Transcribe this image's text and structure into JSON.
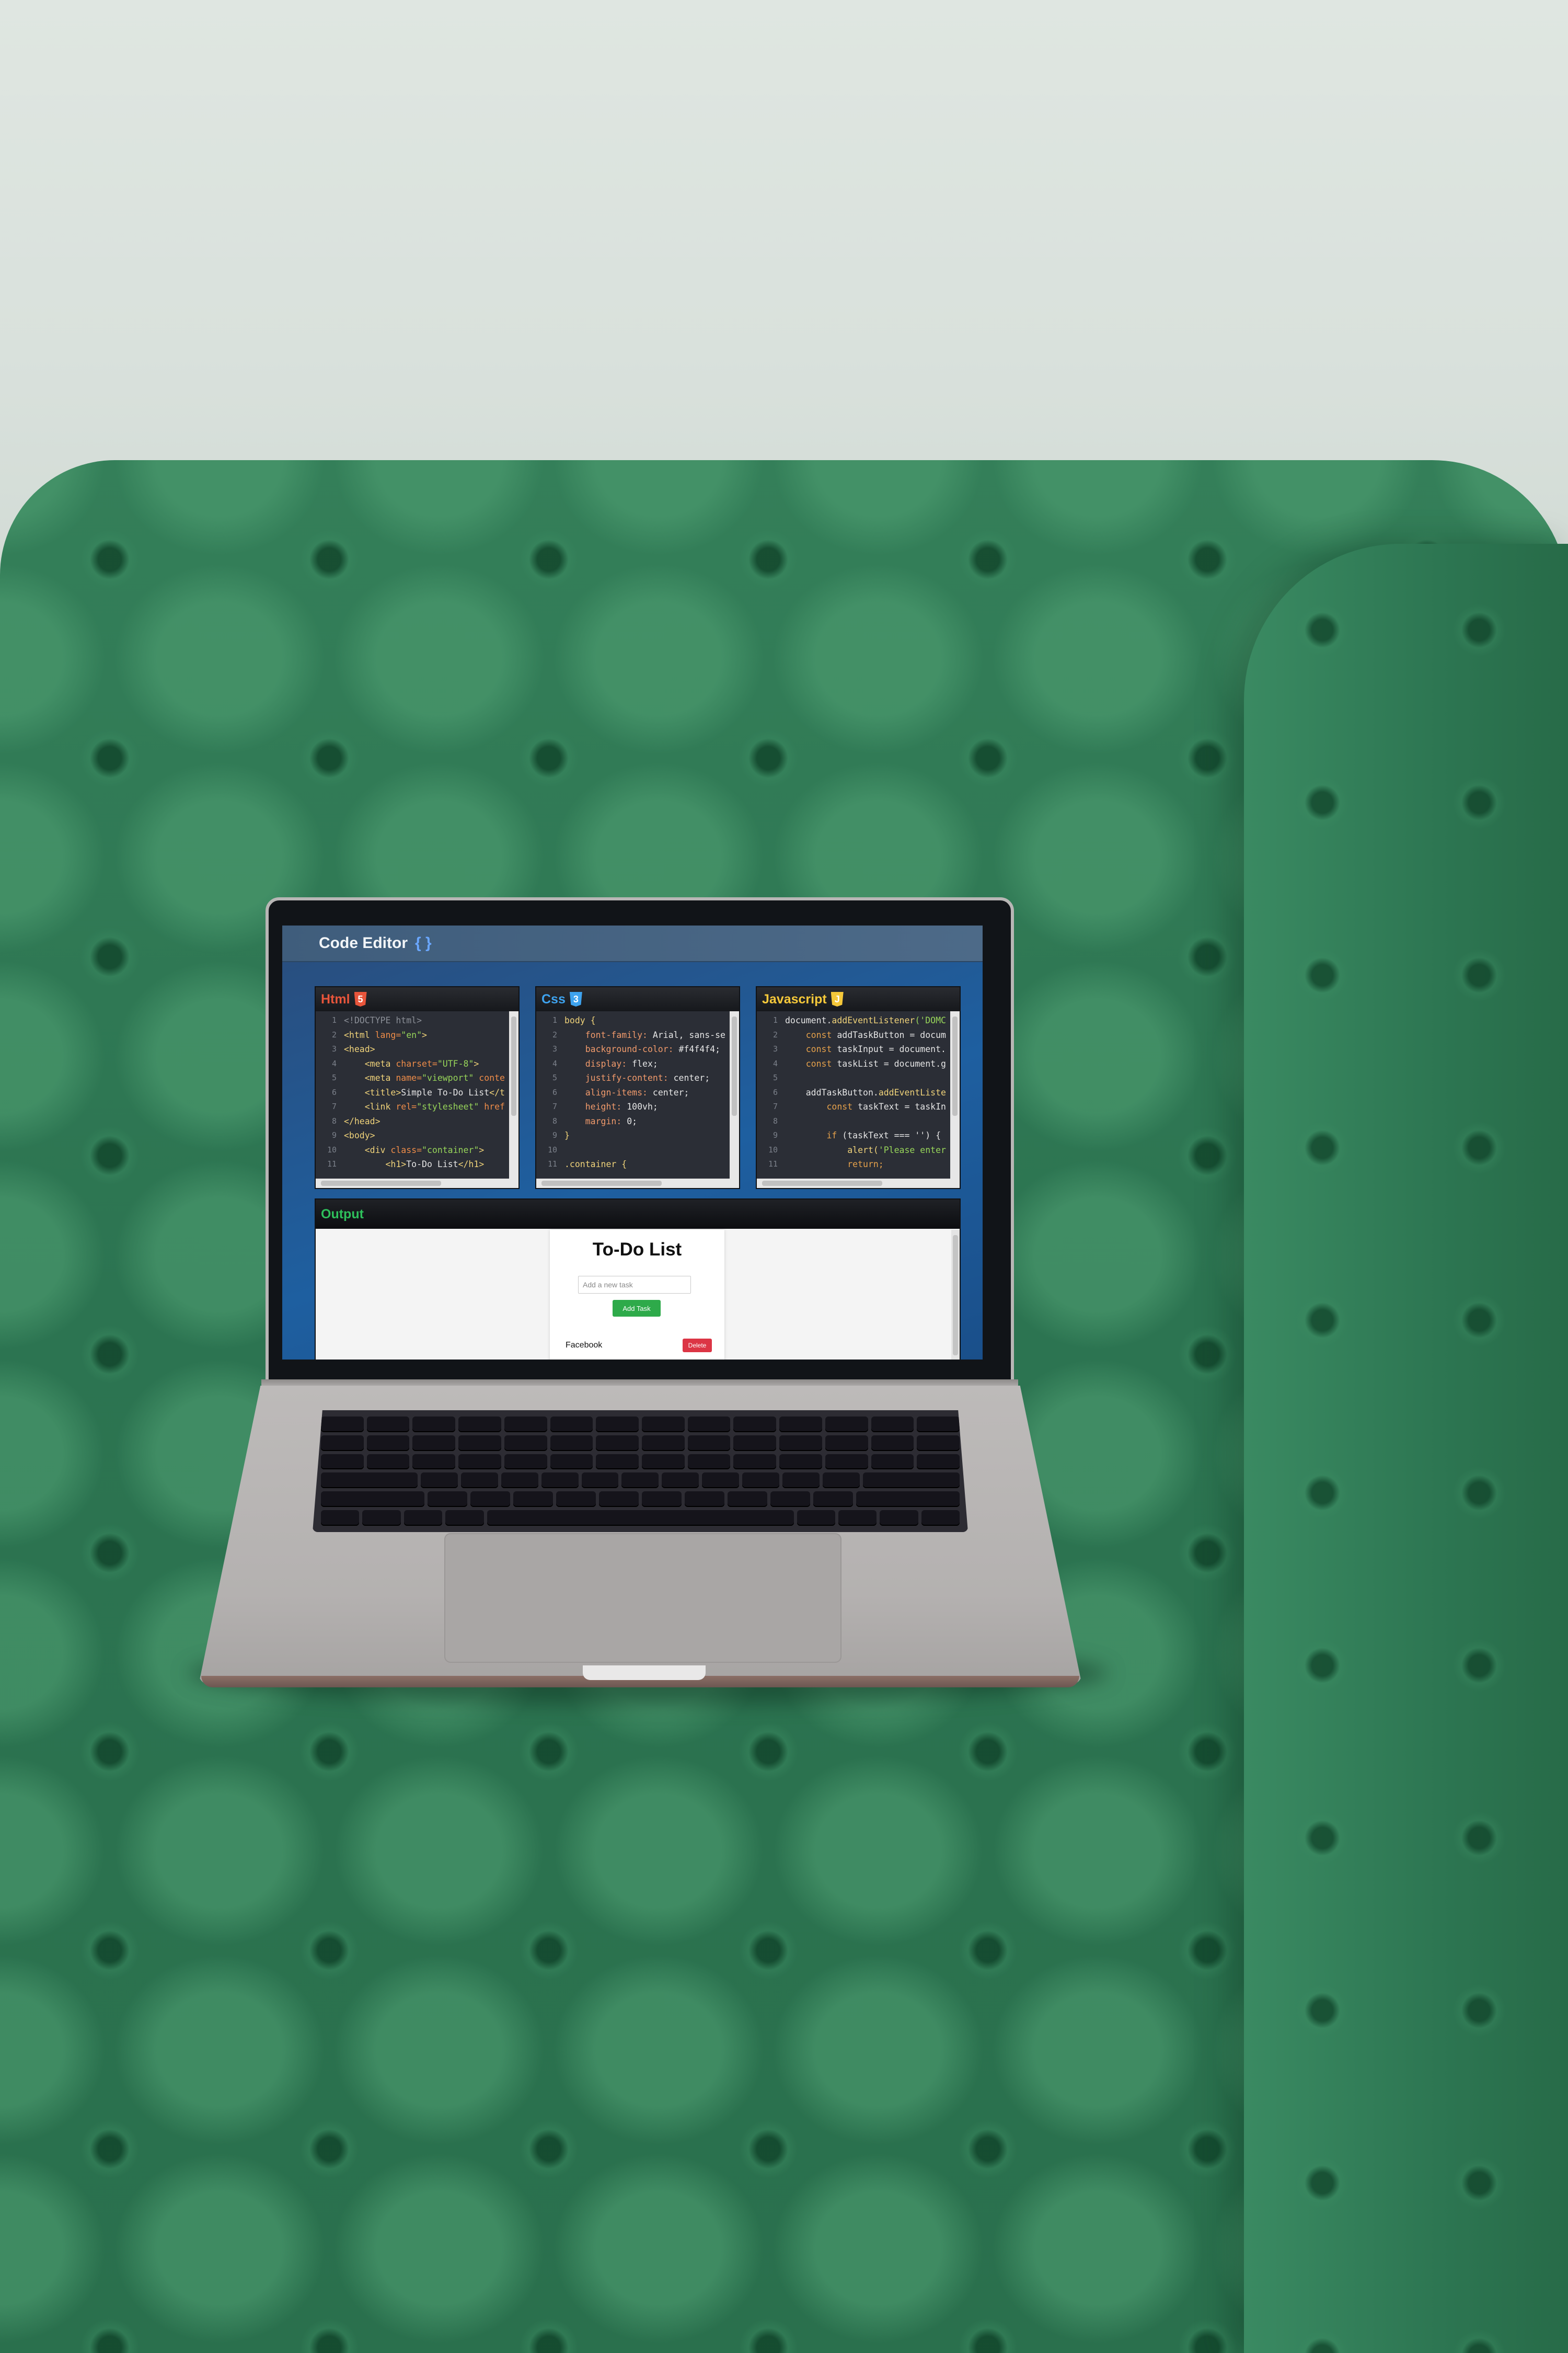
{
  "app": {
    "title": "Code Editor",
    "title_icon": "{ }",
    "accent_color": "#6aa7ff"
  },
  "panels": [
    {
      "name": "Html",
      "color": "#e8553b",
      "icon": "html5-icon",
      "icon_glyph": "5",
      "lines": [
        [
          {
            "t": "<!DOCTYPE html>",
            "c": "c-com"
          }
        ],
        [
          {
            "t": "<html ",
            "c": "c-tag"
          },
          {
            "t": "lang=",
            "c": "c-attr"
          },
          {
            "t": "\"en\"",
            "c": "c-str"
          },
          {
            "t": ">",
            "c": "c-tag"
          }
        ],
        [
          {
            "t": "<head>",
            "c": "c-tag"
          }
        ],
        [
          {
            "t": "    <meta ",
            "c": "c-tag"
          },
          {
            "t": "charset=",
            "c": "c-attr"
          },
          {
            "t": "\"UTF-8\"",
            "c": "c-str"
          },
          {
            "t": ">",
            "c": "c-tag"
          }
        ],
        [
          {
            "t": "    <meta ",
            "c": "c-tag"
          },
          {
            "t": "name=",
            "c": "c-attr"
          },
          {
            "t": "\"viewport\"",
            "c": "c-str"
          },
          {
            "t": " conte",
            "c": "c-attr"
          }
        ],
        [
          {
            "t": "    <title>",
            "c": "c-tag"
          },
          {
            "t": "Simple To-Do List",
            "c": "c-txt"
          },
          {
            "t": "</t",
            "c": "c-tag"
          }
        ],
        [
          {
            "t": "    <link ",
            "c": "c-tag"
          },
          {
            "t": "rel=",
            "c": "c-attr"
          },
          {
            "t": "\"stylesheet\"",
            "c": "c-str"
          },
          {
            "t": " href",
            "c": "c-attr"
          }
        ],
        [
          {
            "t": "</head>",
            "c": "c-tag"
          }
        ],
        [
          {
            "t": "<body>",
            "c": "c-tag"
          }
        ],
        [
          {
            "t": "    <div ",
            "c": "c-tag"
          },
          {
            "t": "class=",
            "c": "c-attr"
          },
          {
            "t": "\"container\"",
            "c": "c-str"
          },
          {
            "t": ">",
            "c": "c-tag"
          }
        ],
        [
          {
            "t": "        <h1>",
            "c": "c-tag"
          },
          {
            "t": "To-Do List",
            "c": "c-txt"
          },
          {
            "t": "</h1>",
            "c": "c-tag"
          }
        ]
      ]
    },
    {
      "name": "Css",
      "color": "#3ea3ef",
      "icon": "css3-icon",
      "icon_glyph": "3",
      "lines": [
        [
          {
            "t": "body {",
            "c": "c-sel"
          }
        ],
        [
          {
            "t": "    font-family: ",
            "c": "c-prop"
          },
          {
            "t": "Arial, sans-se",
            "c": "c-val"
          }
        ],
        [
          {
            "t": "    background-color: ",
            "c": "c-prop"
          },
          {
            "t": "#f4f4f4;",
            "c": "c-val"
          }
        ],
        [
          {
            "t": "    display: ",
            "c": "c-prop"
          },
          {
            "t": "flex;",
            "c": "c-val"
          }
        ],
        [
          {
            "t": "    justify-content: ",
            "c": "c-prop"
          },
          {
            "t": "center;",
            "c": "c-val"
          }
        ],
        [
          {
            "t": "    align-items: ",
            "c": "c-prop"
          },
          {
            "t": "center;",
            "c": "c-val"
          }
        ],
        [
          {
            "t": "    height: ",
            "c": "c-prop"
          },
          {
            "t": "100vh;",
            "c": "c-val"
          }
        ],
        [
          {
            "t": "    margin: ",
            "c": "c-prop"
          },
          {
            "t": "0;",
            "c": "c-val"
          }
        ],
        [
          {
            "t": "}",
            "c": "c-sel"
          }
        ],
        [
          {
            "t": "",
            "c": "c-val"
          }
        ],
        [
          {
            "t": ".container {",
            "c": "c-sel"
          }
        ]
      ]
    },
    {
      "name": "Javascript",
      "color": "#f5c83a",
      "icon": "js-icon",
      "icon_glyph": "J",
      "lines": [
        [
          {
            "t": "document.",
            "c": "c-txt"
          },
          {
            "t": "addEventListener",
            "c": "c-fn"
          },
          {
            "t": "('DOMC",
            "c": "c-str"
          }
        ],
        [
          {
            "t": "    const ",
            "c": "c-kw"
          },
          {
            "t": "addTaskButton = docum",
            "c": "c-txt"
          }
        ],
        [
          {
            "t": "    const ",
            "c": "c-kw"
          },
          {
            "t": "taskInput = document.",
            "c": "c-txt"
          }
        ],
        [
          {
            "t": "    const ",
            "c": "c-kw"
          },
          {
            "t": "taskList = document.g",
            "c": "c-txt"
          }
        ],
        [
          {
            "t": "",
            "c": "c-txt"
          }
        ],
        [
          {
            "t": "    addTaskButton.",
            "c": "c-txt"
          },
          {
            "t": "addEventListe",
            "c": "c-fn"
          }
        ],
        [
          {
            "t": "        const ",
            "c": "c-kw"
          },
          {
            "t": "taskText = taskIn",
            "c": "c-txt"
          }
        ],
        [
          {
            "t": "",
            "c": "c-txt"
          }
        ],
        [
          {
            "t": "        if ",
            "c": "c-kw"
          },
          {
            "t": "(taskText === '') {",
            "c": "c-txt"
          }
        ],
        [
          {
            "t": "            alert(",
            "c": "c-fn"
          },
          {
            "t": "'Please enter",
            "c": "c-str"
          }
        ],
        [
          {
            "t": "            return;",
            "c": "c-kw"
          }
        ]
      ]
    }
  ],
  "output": {
    "title": "Output",
    "todo": {
      "heading": "To-Do List",
      "input_placeholder": "Add a new task",
      "add_label": "Add Task",
      "tasks": [
        {
          "text": "Facebook",
          "delete_label": "Delete"
        }
      ]
    }
  }
}
